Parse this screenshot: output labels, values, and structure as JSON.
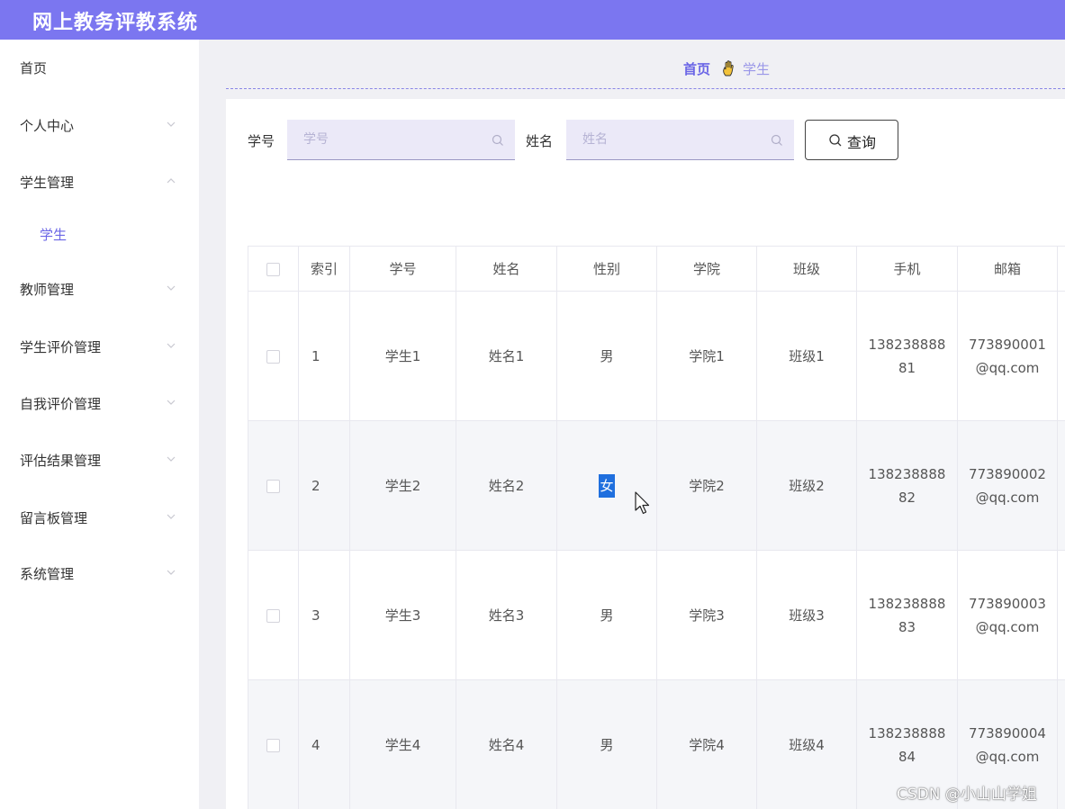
{
  "app": {
    "title": "网上教务评教系统"
  },
  "sidebar": {
    "items": [
      {
        "label": "首页",
        "has_arrow": false
      },
      {
        "label": "个人中心",
        "has_arrow": true,
        "expanded": false
      },
      {
        "label": "学生管理",
        "has_arrow": true,
        "expanded": true,
        "children": [
          {
            "label": "学生",
            "active": true
          }
        ]
      },
      {
        "label": "教师管理",
        "has_arrow": true,
        "expanded": false
      },
      {
        "label": "学生评价管理",
        "has_arrow": true,
        "expanded": false
      },
      {
        "label": "自我评价管理",
        "has_arrow": true,
        "expanded": false
      },
      {
        "label": "评估结果管理",
        "has_arrow": true,
        "expanded": false
      },
      {
        "label": "留言板管理",
        "has_arrow": true,
        "expanded": false
      },
      {
        "label": "系统管理",
        "has_arrow": true,
        "expanded": false
      }
    ]
  },
  "breadcrumb": {
    "home": "首页",
    "separator_icon": "hand-icon",
    "current": "学生"
  },
  "search": {
    "student_id_label": "学号",
    "student_id_placeholder": "学号",
    "name_label": "姓名",
    "name_placeholder": "姓名",
    "query_button": "查询"
  },
  "table": {
    "columns": [
      "索引",
      "学号",
      "姓名",
      "性别",
      "学院",
      "班级",
      "手机",
      "邮箱"
    ],
    "rows": [
      {
        "index": "1",
        "student_id": "学生1",
        "name": "姓名1",
        "gender": "男",
        "college": "学院1",
        "class": "班级1",
        "phone_line1": "138238888",
        "phone_line2": "81",
        "email_line1": "773890001",
        "email_line2": "@qq.com"
      },
      {
        "index": "2",
        "student_id": "学生2",
        "name": "姓名2",
        "gender": "女",
        "college": "学院2",
        "class": "班级2",
        "phone_line1": "138238888",
        "phone_line2": "82",
        "email_line1": "773890002",
        "email_line2": "@qq.com"
      },
      {
        "index": "3",
        "student_id": "学生3",
        "name": "姓名3",
        "gender": "男",
        "college": "学院3",
        "class": "班级3",
        "phone_line1": "138238888",
        "phone_line2": "83",
        "email_line1": "773890003",
        "email_line2": "@qq.com"
      },
      {
        "index": "4",
        "student_id": "学生4",
        "name": "姓名4",
        "gender": "男",
        "college": "学院4",
        "class": "班级4",
        "phone_line1": "138238888",
        "phone_line2": "84",
        "email_line1": "773890004",
        "email_line2": "@qq.com"
      }
    ]
  },
  "watermark": "CSDN @小山山学姐",
  "colors": {
    "header": "#7b76f0",
    "accent": "#6b66e6",
    "selection": "#1f6fde"
  }
}
